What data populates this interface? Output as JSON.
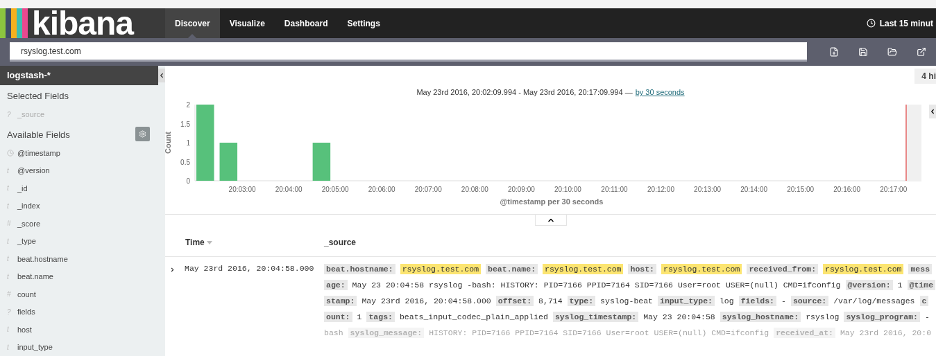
{
  "logo": {
    "text": "kibana"
  },
  "nav": {
    "tabs": [
      {
        "label": "Discover",
        "selected": true
      },
      {
        "label": "Visualize",
        "selected": false
      },
      {
        "label": "Dashboard",
        "selected": false
      },
      {
        "label": "Settings",
        "selected": false
      }
    ],
    "time_picker": "Last 15 minut"
  },
  "search": {
    "value": "rsyslog.test.com"
  },
  "sidebar": {
    "index_pattern": "logstash-*",
    "selected_title": "Selected Fields",
    "selected_fields": [
      {
        "kind": "glyph",
        "glyph": "?",
        "name": "_source"
      }
    ],
    "available_title": "Available Fields",
    "available_fields": [
      {
        "kind": "clock",
        "name": "@timestamp"
      },
      {
        "kind": "glyph",
        "glyph": "t",
        "name": "@version"
      },
      {
        "kind": "glyph",
        "glyph": "t",
        "name": "_id"
      },
      {
        "kind": "glyph",
        "glyph": "t",
        "name": "_index"
      },
      {
        "kind": "glyph",
        "glyph": "#",
        "name": "_score"
      },
      {
        "kind": "glyph",
        "glyph": "t",
        "name": "_type"
      },
      {
        "kind": "glyph",
        "glyph": "t",
        "name": "beat.hostname"
      },
      {
        "kind": "glyph",
        "glyph": "t",
        "name": "beat.name"
      },
      {
        "kind": "glyph",
        "glyph": "#",
        "name": "count"
      },
      {
        "kind": "glyph",
        "glyph": "?",
        "name": "fields"
      },
      {
        "kind": "glyph",
        "glyph": "t",
        "name": "host"
      },
      {
        "kind": "glyph",
        "glyph": "t",
        "name": "input_type"
      }
    ]
  },
  "hits": "4 hi",
  "range": {
    "text": "May 23rd 2016, 20:02:09.994 - May 23rd 2016, 20:17:09.994 —",
    "link": "by 30 seconds"
  },
  "chart_data": {
    "type": "bar",
    "xlabel": "@timestamp per 30 seconds",
    "ylabel": "Count",
    "categories": [
      null,
      null,
      "20:03:00",
      null,
      "20:04:00",
      null,
      "20:05:00",
      null,
      "20:06:00",
      null,
      "20:07:00",
      null,
      "20:08:00",
      null,
      "20:09:00",
      null,
      "20:10:00",
      null,
      "20:11:00",
      null,
      "20:12:00",
      null,
      "20:13:00",
      null,
      "20:14:00",
      null,
      "20:15:00",
      null,
      "20:16:00",
      null,
      "20:17:00"
    ],
    "series": [
      {
        "color": "#57c17b",
        "values": [
          2,
          1,
          0,
          0,
          0,
          1,
          0,
          0,
          0,
          0,
          0,
          0,
          0,
          0,
          0,
          0,
          0,
          0,
          0,
          0,
          0,
          0,
          0,
          0,
          0,
          0,
          0,
          0,
          0,
          0,
          0
        ]
      }
    ],
    "ylim": [
      0,
      2
    ],
    "yticks": [
      0,
      0.5,
      1,
      1.5,
      2
    ]
  },
  "table": {
    "columns": [
      "Time",
      "_source"
    ],
    "rows": [
      {
        "expanded": false,
        "time": "May 23rd 2016, 20:04:58.000",
        "lines": [
          [
            {
              "kind": "key",
              "text": "beat.hostname:"
            },
            {
              "kind": "hit",
              "text": "rsyslog.test.com"
            },
            {
              "kind": "key",
              "text": "beat.name:"
            },
            {
              "kind": "hit",
              "text": "rsyslog.test.com"
            },
            {
              "kind": "key",
              "text": "host:"
            },
            {
              "kind": "hit",
              "text": "rsyslog.test.com"
            },
            {
              "kind": "key",
              "text": "received_from:"
            },
            {
              "kind": "hit",
              "text": "rsyslog.test.com"
            },
            {
              "kind": "key",
              "text": "mess"
            }
          ],
          [
            {
              "kind": "key",
              "text": "age:"
            },
            {
              "kind": "value",
              "text": "May 23 20:04:58 rsyslog -bash: HISTORY: PID=7166 PPID=7164 SID=7166 User=root USER=(null) CMD=ifconfig"
            },
            {
              "kind": "key",
              "text": "@version:"
            },
            {
              "kind": "value",
              "text": "1"
            },
            {
              "kind": "key",
              "text": "@time"
            }
          ],
          [
            {
              "kind": "key",
              "text": "stamp:"
            },
            {
              "kind": "value",
              "text": "May 23rd 2016, 20:04:58.000"
            },
            {
              "kind": "key",
              "text": "offset:"
            },
            {
              "kind": "value",
              "text": "8,714"
            },
            {
              "kind": "key",
              "text": "type:"
            },
            {
              "kind": "value",
              "text": "syslog-beat"
            },
            {
              "kind": "key",
              "text": "input_type:"
            },
            {
              "kind": "value",
              "text": "log"
            },
            {
              "kind": "key",
              "text": "fields:"
            },
            {
              "kind": "value",
              "text": "-"
            },
            {
              "kind": "key",
              "text": "source:"
            },
            {
              "kind": "value",
              "text": "/var/log/messages"
            },
            {
              "kind": "key",
              "text": "c"
            }
          ],
          [
            {
              "kind": "key",
              "text": "ount:"
            },
            {
              "kind": "value",
              "text": "1"
            },
            {
              "kind": "key",
              "text": "tags:"
            },
            {
              "kind": "value",
              "text": "beats_input_codec_plain_applied"
            },
            {
              "kind": "key",
              "text": "syslog_timestamp:"
            },
            {
              "kind": "value",
              "text": "May 23 20:04:58"
            },
            {
              "kind": "key",
              "text": "syslog_hostname:"
            },
            {
              "kind": "value",
              "text": "rsyslog"
            },
            {
              "kind": "key",
              "text": "syslog_program:"
            },
            {
              "kind": "value",
              "text": "-"
            }
          ],
          [
            {
              "kind": "value",
              "text": "bash"
            },
            {
              "kind": "key",
              "text": "syslog_message:"
            },
            {
              "kind": "value",
              "text": "HISTORY: PID=7166 PPID=7164 SID=7166 User=root USER=(null) CMD=ifconfig"
            },
            {
              "kind": "key",
              "text": "received_at:"
            },
            {
              "kind": "value",
              "text": "May 23rd 2016, 20:0"
            }
          ]
        ]
      }
    ]
  }
}
